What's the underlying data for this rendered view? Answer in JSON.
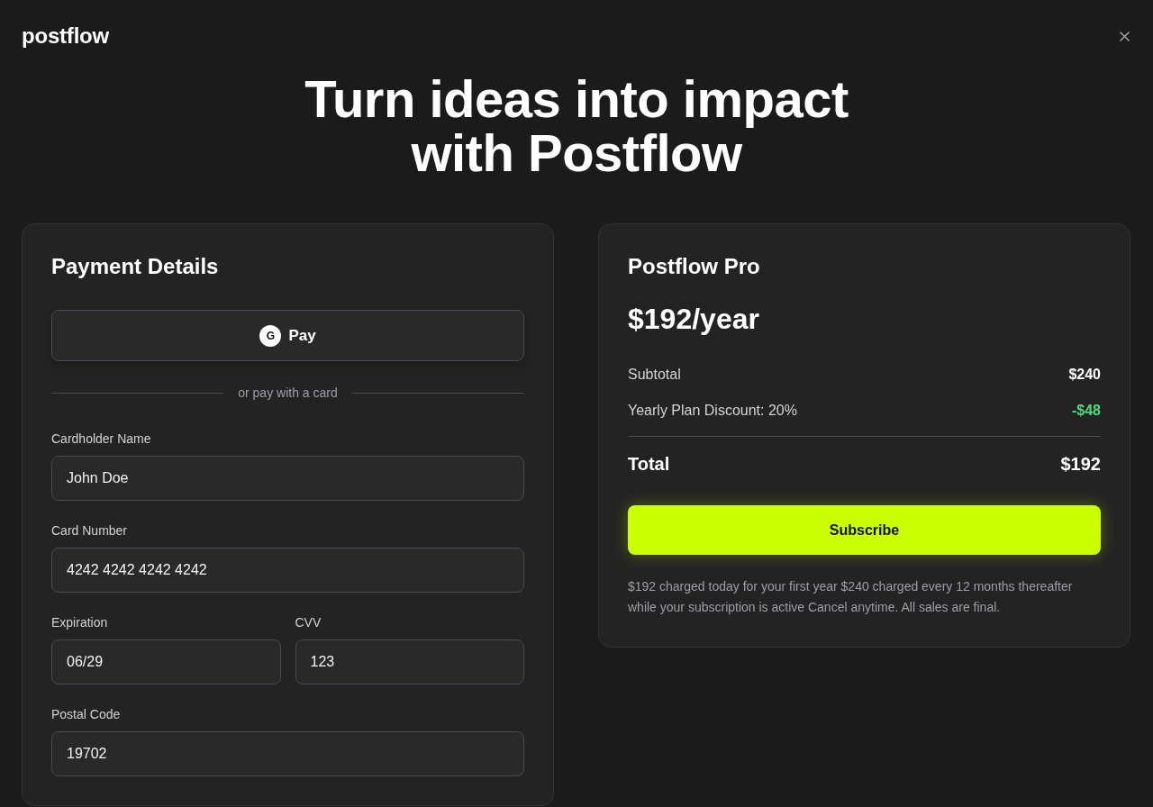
{
  "brand": {
    "logo": "postflow"
  },
  "headline": [
    "Turn ideas into impact",
    "with Postflow"
  ],
  "payment": {
    "title": "Payment Details",
    "wallet_button": {
      "icon_letter": "G",
      "label": "Pay"
    },
    "divider_text": "or pay with a card",
    "field_rows": [
      [
        {
          "label": "Cardholder Name",
          "value": "John Doe"
        }
      ],
      [
        {
          "label": "Card Number",
          "value": "4242 4242 4242 4242"
        }
      ],
      [
        {
          "label": "Expiration",
          "value": "06/29"
        },
        {
          "label": "CVV",
          "value": "123"
        }
      ],
      [
        {
          "label": "Postal Code",
          "value": "19702"
        }
      ]
    ]
  },
  "summary": {
    "plan": "Postflow Pro",
    "price": "$192/year",
    "lines": [
      {
        "label": "Subtotal",
        "amount": "$240",
        "kind": "charge"
      },
      {
        "label": "Yearly Plan Discount: 20%",
        "amount": "-$48",
        "kind": "discount"
      }
    ],
    "total": {
      "label": "Total",
      "amount": "$192"
    },
    "subscribe_button": "Subscribe",
    "note": "$192 charged today for your first year $240 charged every 12 months thereafter while your subscription is active Cancel anytime. All sales are final."
  }
}
